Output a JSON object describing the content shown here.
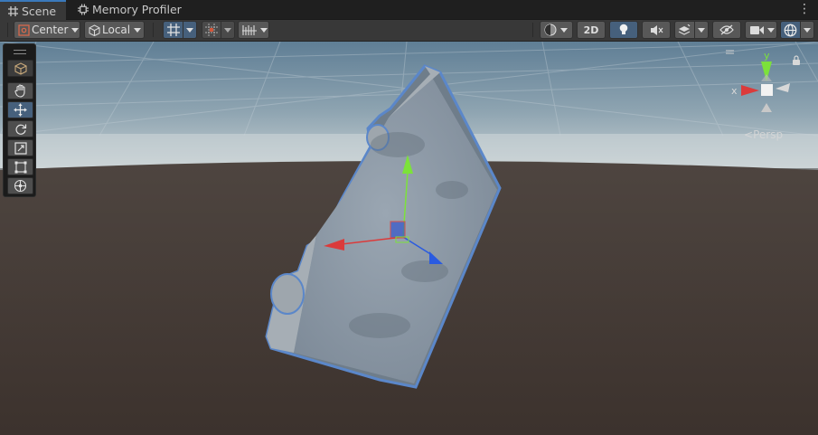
{
  "tabs": [
    {
      "label": "Scene",
      "icon": "grid-hash-icon",
      "active": true
    },
    {
      "label": "Memory Profiler",
      "icon": "gear-chip-icon",
      "active": false
    }
  ],
  "toolbar": {
    "pivot_mode": "Center",
    "pivot_rotation": "Local",
    "toggle_2d": "2D"
  },
  "gizmo": {
    "axis_y": "y",
    "axis_x": "x",
    "projection": "Persp"
  },
  "tools": [
    "view-tool",
    "hand-tool",
    "move-tool",
    "rotate-tool",
    "scale-tool",
    "rect-tool",
    "transform-tool"
  ],
  "colors": {
    "accent": "#46607c",
    "x_axis": "#db3b3b",
    "y_axis": "#7ce23a",
    "z_axis": "#2a5be0",
    "selection_outline": "#5b87c9"
  }
}
